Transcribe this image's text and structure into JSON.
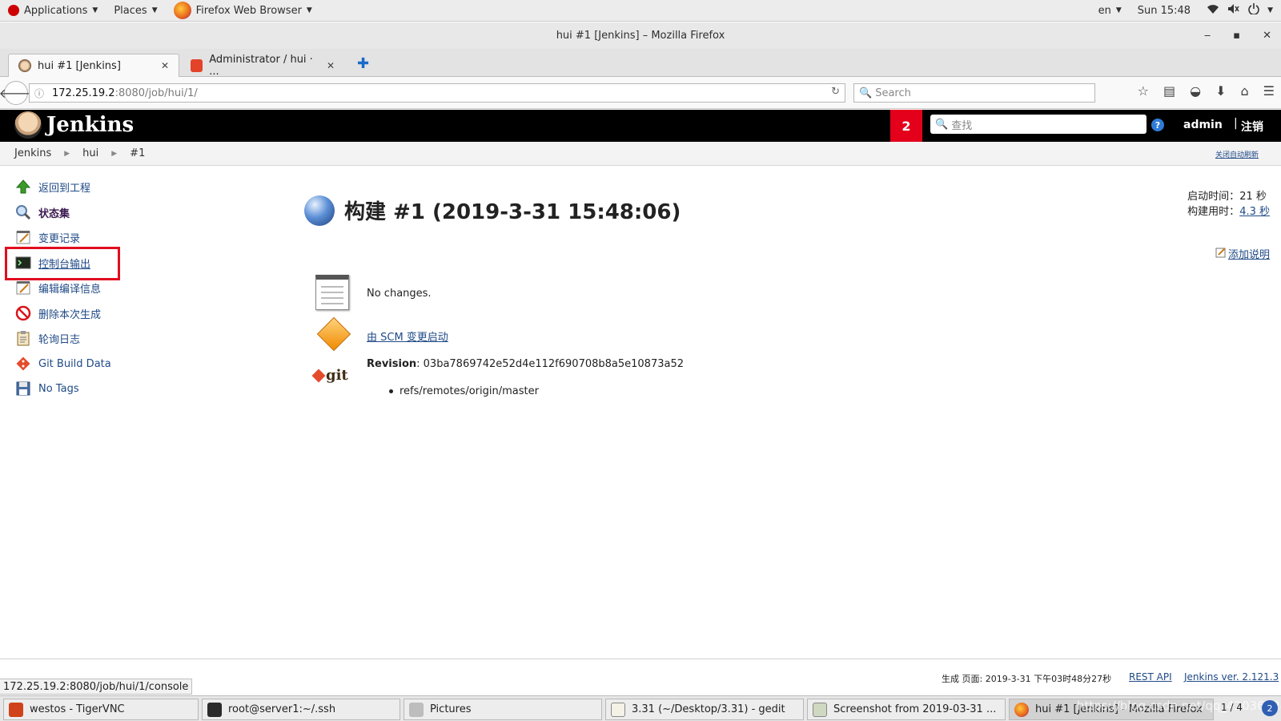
{
  "gnome_bar": {
    "applications": "Applications",
    "places": "Places",
    "browser": "Firefox Web Browser",
    "lang": "en",
    "clock": "Sun 15:48"
  },
  "window": {
    "title": "hui #1 [Jenkins] – Mozilla Firefox"
  },
  "tabs": [
    {
      "label": "hui #1 [Jenkins]",
      "active": true
    },
    {
      "label": "Administrator / hui · ...",
      "active": false
    }
  ],
  "nav": {
    "url_host": "172.25.19.2",
    "url_path": ":8080/job/hui/1/",
    "search_placeholder": "Search"
  },
  "jenkins": {
    "brand": "Jenkins",
    "notification_count": "2",
    "search_placeholder": "查找",
    "user": "admin",
    "logout": "注销"
  },
  "breadcrumb": {
    "items": [
      "Jenkins",
      "hui",
      "#1"
    ],
    "auto_refresh": "关闭自动刷新"
  },
  "sidebar": {
    "items": [
      {
        "label": "返回到工程",
        "icon": "up-arrow-icon"
      },
      {
        "label": "状态集",
        "icon": "magnifier-icon"
      },
      {
        "label": "变更记录",
        "icon": "notepad-icon"
      },
      {
        "label": "控制台输出",
        "icon": "terminal-icon"
      },
      {
        "label": "编辑编译信息",
        "icon": "notepad-edit-icon"
      },
      {
        "label": "删除本次生成",
        "icon": "no-entry-icon"
      },
      {
        "label": "轮询日志",
        "icon": "clipboard-icon"
      },
      {
        "label": "Git Build Data",
        "icon": "git-icon"
      },
      {
        "label": "No Tags",
        "icon": "floppy-icon"
      }
    ]
  },
  "build": {
    "title": "构建 #1 (2019-3-31 15:48:06)",
    "started_label": "启动时间：",
    "started_value": "21 秒",
    "duration_label": "构建用时：",
    "duration_value": "4.3 秒",
    "add_description": "添加说明",
    "no_changes": "No changes.",
    "scm_trigger": "由 SCM 变更启动",
    "revision_label": "Revision",
    "revision_hash": ": 03ba7869742e52d4e112f690708b8a5e10873a52",
    "ref": "refs/remotes/origin/master"
  },
  "footer": {
    "generated": "生成 页面: 2019-3-31 下午03时48分27秒",
    "rest_api": "REST API",
    "version": "Jenkins ver. 2.121.3"
  },
  "status_url": "172.25.19.2:8080/job/hui/1/console",
  "taskbar": {
    "items": [
      {
        "label": "westos - TigerVNC"
      },
      {
        "label": "root@server1:~/.ssh"
      },
      {
        "label": "Pictures"
      },
      {
        "label": "3.31 (~/Desktop/3.31) - gedit"
      },
      {
        "label": "Screenshot from 2019-03-31 ..."
      },
      {
        "label": "hui #1 [Jenkins] - Mozilla Firefox"
      }
    ],
    "pager": "1 / 4",
    "watermark": "https://blog.csdn.net/qq_42036824"
  },
  "colors": {
    "jenkins_header": "#000000",
    "badge": "#e4001b",
    "link": "#204a87",
    "highlight_box": "#e10d1f"
  }
}
